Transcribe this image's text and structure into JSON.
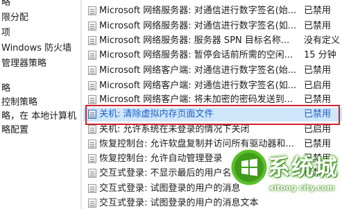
{
  "tree": {
    "items": [
      {
        "label": "略"
      },
      {
        "label": "限分配"
      },
      {
        "label": "项"
      },
      {
        "label": "Windows 防火墙"
      },
      {
        "label": "管理器策略"
      },
      {
        "label": "略"
      },
      {
        "label": "控制策略"
      },
      {
        "label": "略，在 本地计算机"
      },
      {
        "label": "略配置"
      }
    ]
  },
  "policies": {
    "rows": [
      {
        "name": "Microsoft 网络服务器: 对通信进行数字签名(始...",
        "state": "已禁用"
      },
      {
        "name": "Microsoft 网络服务器: 对通信进行数字签名(如...",
        "state": "已禁用"
      },
      {
        "name": "Microsoft 网络服务器: 服务器 SPN 目标名称...",
        "state": "没有定义"
      },
      {
        "name": "Microsoft 网络服务器: 暂停会话前所需的空闲...",
        "state": "15 分钟"
      },
      {
        "name": "Microsoft 网络客户端: 对通信进行数字签名(始...",
        "state": "已禁用"
      },
      {
        "name": "Microsoft 网络客户端: 对通信进行数字签名(如...",
        "state": "已启用"
      },
      {
        "name": "Microsoft 网络客户端: 将未加密的密码发送到...",
        "state": "已禁用"
      },
      {
        "name": "关机: 清除虚拟内存页面文件",
        "state": "已禁用"
      },
      {
        "name": "关机: 允许系统在未登录的情况下关闭",
        "state": "已启用"
      },
      {
        "name": "恢复控制台: 允许软盘复制并访问所有驱动器和...",
        "state": "已禁用"
      },
      {
        "name": "恢复控制台: 允许自动管理登录",
        "state": "已禁用"
      },
      {
        "name": "交互式登录: 不显示最后的用户名",
        "state": "已禁用"
      },
      {
        "name": "交互式登录: 试图登录的用户的消息",
        "state": ""
      },
      {
        "name": "交互式登录: 试图登录的用户的消息文本",
        "state": ""
      }
    ]
  },
  "watermark": {
    "text": "系统城",
    "url": "xitong city.com"
  },
  "colors": {
    "selection": "#cfe6fb",
    "highlight_border": "#d0202a",
    "watermark_green": "#4caf20"
  }
}
